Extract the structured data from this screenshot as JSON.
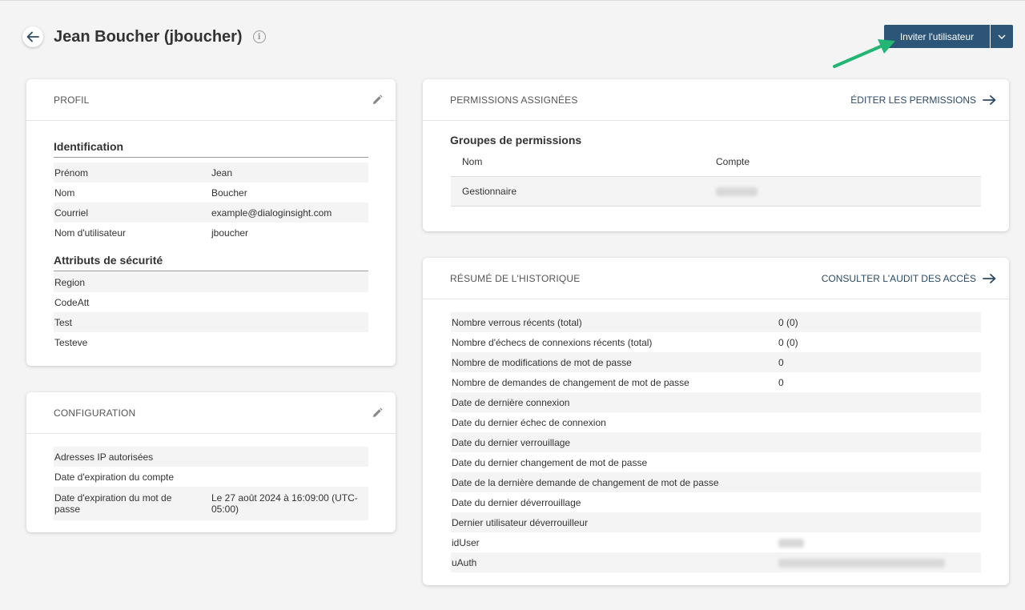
{
  "header": {
    "title": "Jean Boucher (jboucher)",
    "invite_label": "Inviter l'utilisateur"
  },
  "profile": {
    "title": "PROFIL",
    "identification_title": "Identification",
    "identification": [
      {
        "label": "Prénom",
        "value": "Jean"
      },
      {
        "label": "Nom",
        "value": "Boucher"
      },
      {
        "label": "Courriel",
        "value": "example@dialoginsight.com"
      },
      {
        "label": "Nom d'utilisateur",
        "value": "jboucher"
      }
    ],
    "security_title": "Attributs de sécurité",
    "security": [
      {
        "label": "Region",
        "value": ""
      },
      {
        "label": "CodeAtt",
        "value": ""
      },
      {
        "label": "Test",
        "value": ""
      },
      {
        "label": "Testeve",
        "value": ""
      }
    ]
  },
  "configuration": {
    "title": "CONFIGURATION",
    "rows": [
      {
        "label": "Adresses IP autorisées",
        "value": ""
      },
      {
        "label": "Date d'expiration du compte",
        "value": ""
      },
      {
        "label": "Date d'expiration du mot de passe",
        "value": "Le 27 août 2024 à 16:09:00 (UTC-05:00)"
      }
    ]
  },
  "permissions": {
    "title": "PERMISSIONS ASSIGNÉES",
    "edit_link": "ÉDITER LES PERMISSIONS",
    "groups_title": "Groupes de permissions",
    "col_name": "Nom",
    "col_account": "Compte",
    "rows": [
      {
        "name": "Gestionnaire",
        "account": ""
      }
    ]
  },
  "history": {
    "title": "RÉSUMÉ DE L'HISTORIQUE",
    "audit_link": "CONSULTER L'AUDIT DES ACCÈS",
    "rows": [
      {
        "label": "Nombre verrous récents (total)",
        "value": "0 (0)"
      },
      {
        "label": "Nombre d'échecs de connexions récents (total)",
        "value": "0 (0)"
      },
      {
        "label": "Nombre de modifications de mot de passe",
        "value": "0"
      },
      {
        "label": "Nombre de demandes de changement de mot de passe",
        "value": "0"
      },
      {
        "label": "Date de dernière connexion",
        "value": ""
      },
      {
        "label": "Date du dernier échec de connexion",
        "value": ""
      },
      {
        "label": "Date du dernier verrouillage",
        "value": ""
      },
      {
        "label": "Date du dernier changement de mot de passe",
        "value": ""
      },
      {
        "label": "Date de la dernière demande de changement de mot de passe",
        "value": ""
      },
      {
        "label": "Date du dernier déverrouillage",
        "value": ""
      },
      {
        "label": "Dernier utilisateur déverrouilleur",
        "value": ""
      },
      {
        "label": "idUser",
        "value": ""
      },
      {
        "label": "uAuth",
        "value": ""
      }
    ]
  },
  "colors": {
    "primary": "#2d5578",
    "annotation_arrow": "#22b573"
  }
}
